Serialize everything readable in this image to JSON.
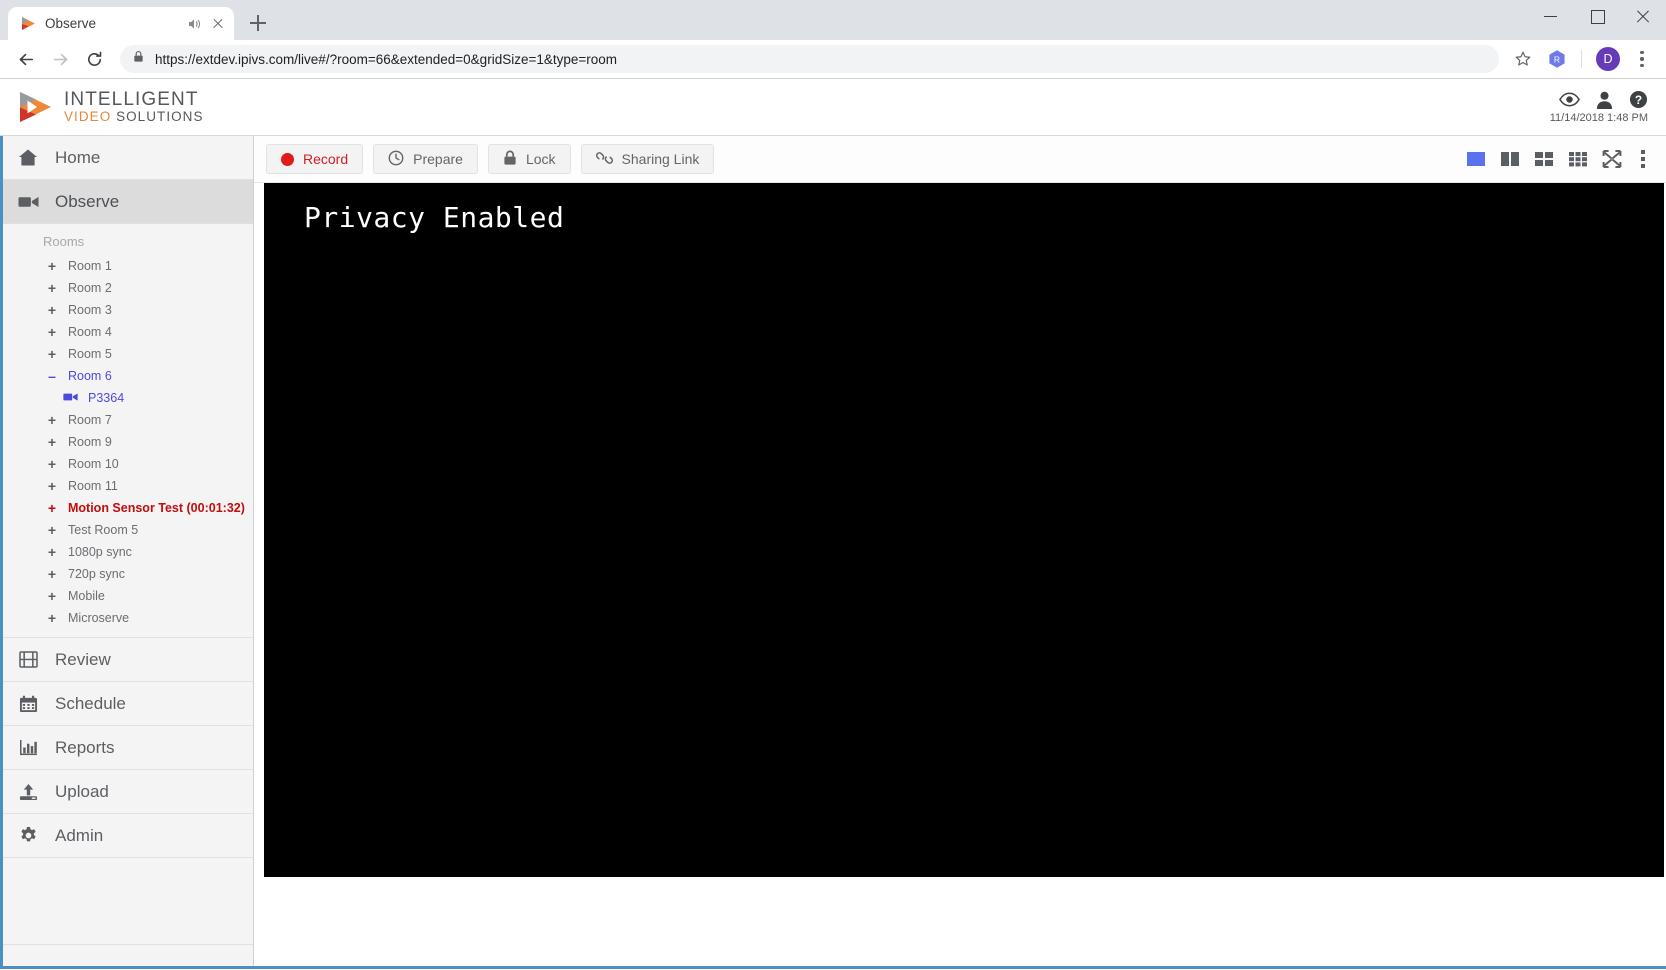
{
  "browser": {
    "tab": {
      "title": "Observe",
      "favicon": "ivs-play-logo-icon",
      "audio_icon": "speaker-icon",
      "close_icon": "close-icon"
    },
    "new_tab_label": "+",
    "window_controls": {
      "minimize": "minimize-icon",
      "maximize": "maximize-icon",
      "close": "close-icon"
    },
    "nav": {
      "back": "back-arrow-icon",
      "forward": "forward-arrow-icon",
      "reload": "reload-icon"
    },
    "omnibox": {
      "lock_icon": "lock-icon",
      "url_scheme_host": "https://extdev.ipivs.com",
      "url_path": "/live#/?room=66&extended=0&gridSize=1&type=room",
      "full_url": "https://extdev.ipivs.com/live#/?room=66&extended=0&gridSize=1&type=room"
    },
    "star_icon": "bookmark-star-icon",
    "extension_badge": "R",
    "profile_avatar": "D",
    "menu_icon": "three-dot-menu-icon"
  },
  "app_header": {
    "logo_line1": "INTELLIGENT",
    "logo_video": "VIDEO",
    "logo_solutions": " SOLUTIONS",
    "icons": [
      "eye-icon",
      "user-icon",
      "help-icon"
    ],
    "timestamp": "11/14/2018 1:48 PM"
  },
  "sidebar": {
    "accent_color": "#4a90c4",
    "items": [
      {
        "label": "Home",
        "icon": "home-icon",
        "active": false
      },
      {
        "label": "Observe",
        "icon": "video-camera-icon",
        "active": true
      }
    ],
    "rooms_caption": "Rooms",
    "rooms": [
      {
        "label": "Room 1",
        "sign": "+",
        "state": "collapsed"
      },
      {
        "label": "Room 2",
        "sign": "+",
        "state": "collapsed"
      },
      {
        "label": "Room 3",
        "sign": "+",
        "state": "collapsed"
      },
      {
        "label": "Room 4",
        "sign": "+",
        "state": "collapsed"
      },
      {
        "label": "Room 5",
        "sign": "+",
        "state": "collapsed"
      },
      {
        "label": "Room 6",
        "sign": "–",
        "state": "expanded"
      },
      {
        "label": "Room 7",
        "sign": "+",
        "state": "collapsed"
      },
      {
        "label": "Room 9",
        "sign": "+",
        "state": "collapsed"
      },
      {
        "label": "Room 10",
        "sign": "+",
        "state": "collapsed"
      },
      {
        "label": "Room 11",
        "sign": "+",
        "state": "collapsed"
      },
      {
        "label": "Motion Sensor Test (00:01:32)",
        "sign": "+",
        "state": "alert"
      },
      {
        "label": "Test Room 5",
        "sign": "+",
        "state": "collapsed"
      },
      {
        "label": "1080p sync",
        "sign": "+",
        "state": "collapsed"
      },
      {
        "label": "720p sync",
        "sign": "+",
        "state": "collapsed"
      },
      {
        "label": "Mobile",
        "sign": "+",
        "state": "collapsed"
      },
      {
        "label": "Microserve",
        "sign": "+",
        "state": "collapsed"
      }
    ],
    "camera": {
      "label": "P3364",
      "icon": "video-camera-icon"
    },
    "bottom_items": [
      {
        "label": "Review",
        "icon": "film-strip-icon"
      },
      {
        "label": "Schedule",
        "icon": "calendar-icon"
      },
      {
        "label": "Reports",
        "icon": "bar-chart-icon"
      },
      {
        "label": "Upload",
        "icon": "upload-icon"
      },
      {
        "label": "Admin",
        "icon": "gear-icon"
      }
    ]
  },
  "toolbar": {
    "record_label": "Record",
    "prepare_label": "Prepare",
    "lock_label": "Lock",
    "sharing_link_label": "Sharing Link",
    "record_color": "#cf2026",
    "layouts": [
      {
        "name": "grid-1up-icon",
        "active": true
      },
      {
        "name": "grid-2up-icon",
        "active": false
      },
      {
        "name": "grid-4up-icon",
        "active": false
      },
      {
        "name": "grid-9up-icon",
        "active": false
      },
      {
        "name": "fullscreen-expand-icon",
        "active": false
      }
    ],
    "active_layout_color": "#5b72ef",
    "overflow_icon": "three-dot-menu-icon"
  },
  "video": {
    "status_text": "Privacy Enabled",
    "background_color": "#000000",
    "text_color": "#ffffff"
  }
}
